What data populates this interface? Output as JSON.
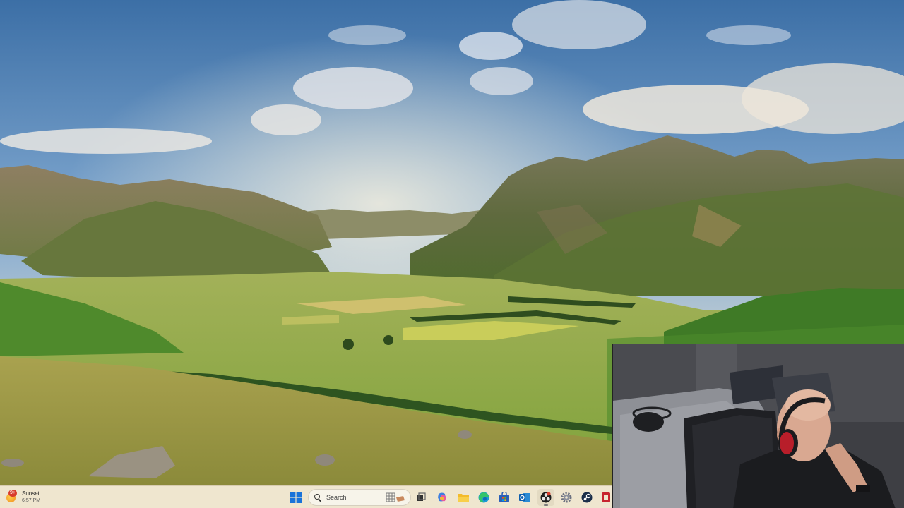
{
  "desktop": {
    "wallpaper": "mountain-valley-landscape"
  },
  "taskbar": {
    "weather": {
      "badge": "9+",
      "title": "Sunset",
      "time": "6:57 PM",
      "icon": "sun-icon"
    },
    "search": {
      "label": "Search",
      "icon": "search-icon"
    },
    "apps": [
      {
        "name": "start-button",
        "icon": "windows-logo-icon"
      },
      {
        "name": "task-view-button",
        "icon": "task-view-icon"
      },
      {
        "name": "copilot-button",
        "icon": "copilot-icon"
      },
      {
        "name": "file-explorer-button",
        "icon": "folder-icon"
      },
      {
        "name": "edge-button",
        "icon": "edge-icon"
      },
      {
        "name": "store-button",
        "icon": "store-icon"
      },
      {
        "name": "outlook-button",
        "icon": "outlook-icon"
      },
      {
        "name": "obs-button",
        "icon": "obs-icon"
      },
      {
        "name": "settings-button",
        "icon": "gear-icon"
      },
      {
        "name": "steam-button",
        "icon": "steam-icon"
      },
      {
        "name": "app-button",
        "icon": "red-app-icon"
      }
    ]
  },
  "webcam": {
    "subject": "streamer-webcam-feed"
  },
  "colors": {
    "taskbar_bg": "#efe6cf",
    "accent_blue": "#1a73d9"
  }
}
